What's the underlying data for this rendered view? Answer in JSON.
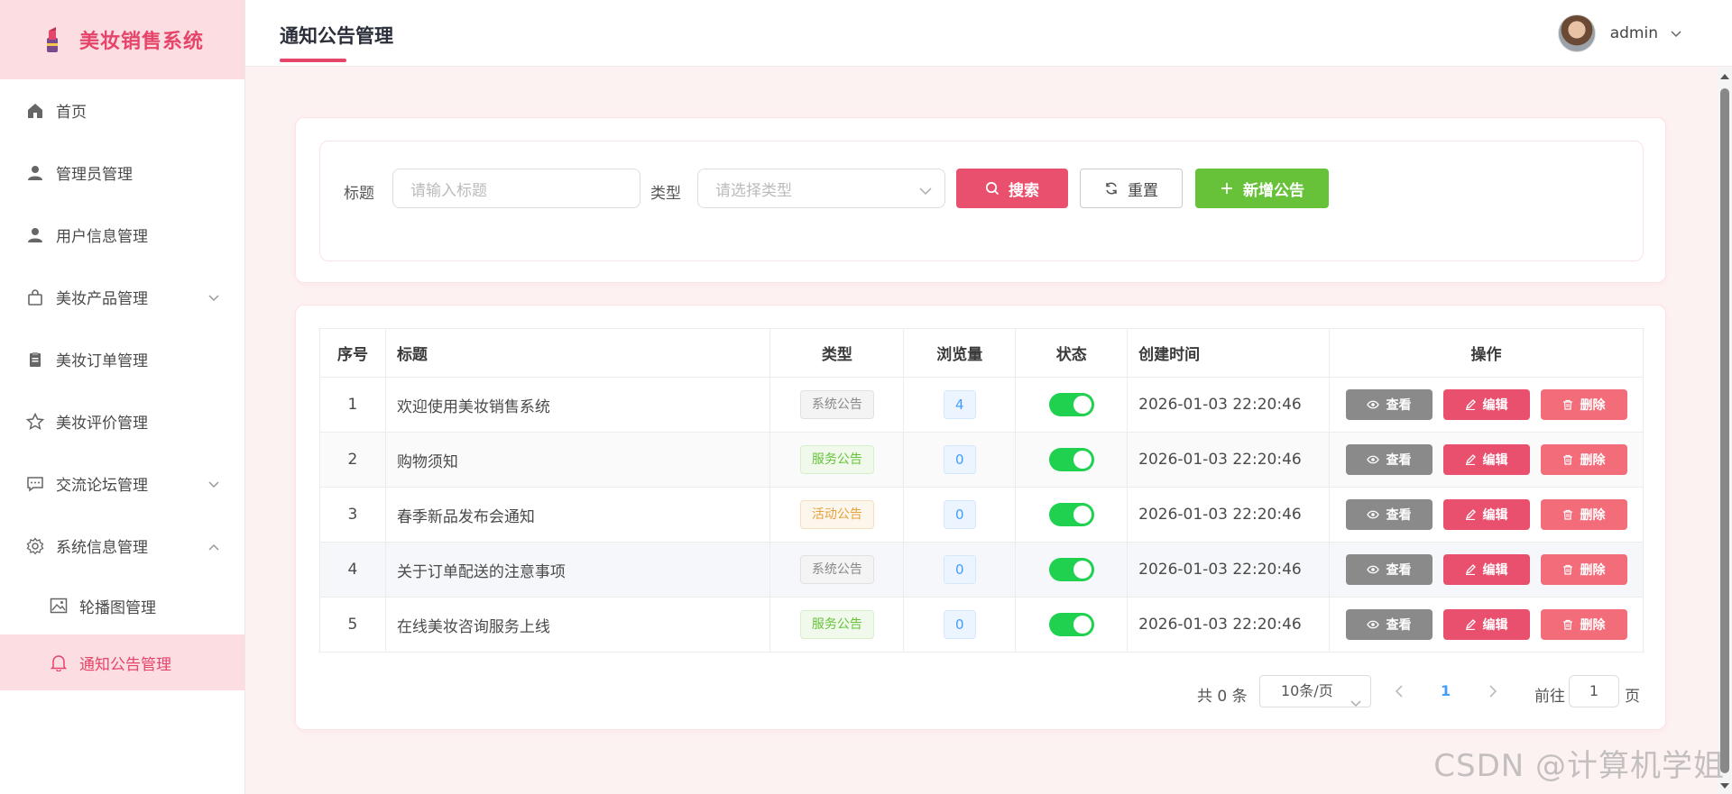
{
  "app": {
    "title": "美妆销售系统"
  },
  "sidebar": {
    "items": [
      {
        "label": "首页",
        "icon": "home-icon"
      },
      {
        "label": "管理员管理",
        "icon": "user-icon"
      },
      {
        "label": "用户信息管理",
        "icon": "user-icon"
      },
      {
        "label": "美妆产品管理",
        "icon": "bag-icon",
        "expandable": true
      },
      {
        "label": "美妆订单管理",
        "icon": "clipboard-icon"
      },
      {
        "label": "美妆评价管理",
        "icon": "star-icon"
      },
      {
        "label": "交流论坛管理",
        "icon": "chat-icon",
        "expandable": true
      },
      {
        "label": "系统信息管理",
        "icon": "gear-icon",
        "expanded": true
      }
    ],
    "sub_items": [
      {
        "label": "轮播图管理",
        "icon": "image-icon"
      },
      {
        "label": "通知公告管理",
        "icon": "bell-icon",
        "active": true
      }
    ]
  },
  "header": {
    "page_title": "通知公告管理",
    "username": "admin"
  },
  "search": {
    "title_label": "标题",
    "title_placeholder": "请输入标题",
    "type_label": "类型",
    "type_placeholder": "请选择类型",
    "search_button": "搜索",
    "reset_button": "重置",
    "add_button": "新增公告"
  },
  "table": {
    "columns": [
      "序号",
      "标题",
      "类型",
      "浏览量",
      "状态",
      "创建时间",
      "操作"
    ],
    "rows": [
      {
        "index": "1",
        "title": "欢迎使用美妆销售系统",
        "type": "系统公告",
        "type_kind": "system",
        "views": "4",
        "status_on": true,
        "created": "2026-01-03 22:20:46"
      },
      {
        "index": "2",
        "title": "购物须知",
        "type": "服务公告",
        "type_kind": "service",
        "views": "0",
        "status_on": true,
        "created": "2026-01-03 22:20:46"
      },
      {
        "index": "3",
        "title": "春季新品发布会通知",
        "type": "活动公告",
        "type_kind": "activity",
        "views": "0",
        "status_on": true,
        "created": "2026-01-03 22:20:46"
      },
      {
        "index": "4",
        "title": "关于订单配送的注意事项",
        "type": "系统公告",
        "type_kind": "system",
        "views": "0",
        "status_on": true,
        "created": "2026-01-03 22:20:46"
      },
      {
        "index": "5",
        "title": "在线美妆咨询服务上线",
        "type": "服务公告",
        "type_kind": "service",
        "views": "0",
        "status_on": true,
        "created": "2026-01-03 22:20:46"
      }
    ],
    "actions": {
      "view": "查看",
      "edit": "编辑",
      "delete": "删除"
    }
  },
  "pagination": {
    "total": "共 0 条",
    "page_size": "10条/页",
    "current_page": "1",
    "goto_label": "前往",
    "goto_value": "1",
    "goto_suffix": "页"
  },
  "watermark": "CSDN @计算机学姐",
  "colors": {
    "accent": "#e6456a",
    "success": "#67c23a",
    "switch_on": "#1fd14f",
    "info_blue": "#409eff"
  }
}
